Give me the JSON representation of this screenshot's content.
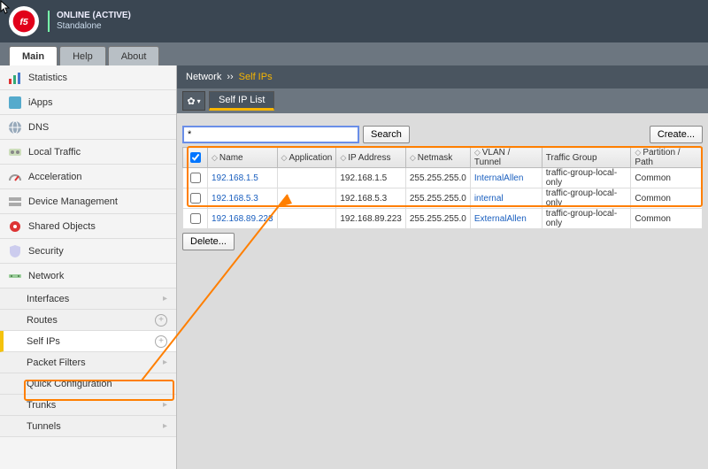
{
  "header": {
    "status": "ONLINE (ACTIVE)",
    "mode": "Standalone"
  },
  "top_tabs": {
    "main": "Main",
    "help": "Help",
    "about": "About"
  },
  "sidebar": {
    "items": [
      {
        "label": "Statistics"
      },
      {
        "label": "iApps"
      },
      {
        "label": "DNS"
      },
      {
        "label": "Local Traffic"
      },
      {
        "label": "Acceleration"
      },
      {
        "label": "Device Management"
      },
      {
        "label": "Shared Objects"
      },
      {
        "label": "Security"
      },
      {
        "label": "Network"
      }
    ],
    "network_sub": [
      {
        "label": "Interfaces",
        "suffix": "chev"
      },
      {
        "label": "Routes",
        "suffix": "plus"
      },
      {
        "label": "Self IPs",
        "suffix": "plus",
        "selected": true
      },
      {
        "label": "Packet Filters",
        "suffix": "chev"
      },
      {
        "label": "Quick Configuration",
        "suffix": ""
      },
      {
        "label": "Trunks",
        "suffix": "chev"
      },
      {
        "label": "Tunnels",
        "suffix": "chev"
      }
    ]
  },
  "breadcrumb": {
    "section": "Network",
    "page": "Self IPs",
    "sep": "››"
  },
  "tabs": {
    "list": "Self IP List"
  },
  "search": {
    "value": "*",
    "button": "Search"
  },
  "buttons": {
    "create": "Create...",
    "delete": "Delete..."
  },
  "columns": {
    "name": "Name",
    "application": "Application",
    "ip": "IP Address",
    "netmask": "Netmask",
    "vlan": "VLAN / Tunnel",
    "tg": "Traffic Group",
    "partition": "Partition / Path"
  },
  "rows": [
    {
      "name": "192.168.1.5",
      "ip": "192.168.1.5",
      "netmask": "255.255.255.0",
      "vlan": "InternalAllen",
      "tg": "traffic-group-local-only",
      "partition": "Common"
    },
    {
      "name": "192.168.5.3",
      "ip": "192.168.5.3",
      "netmask": "255.255.255.0",
      "vlan": "internal",
      "tg": "traffic-group-local-only",
      "partition": "Common"
    },
    {
      "name": "192.168.89.223",
      "ip": "192.168.89.223",
      "netmask": "255.255.255.0",
      "vlan": "ExternalAllen",
      "tg": "traffic-group-local-only",
      "partition": "Common"
    }
  ]
}
